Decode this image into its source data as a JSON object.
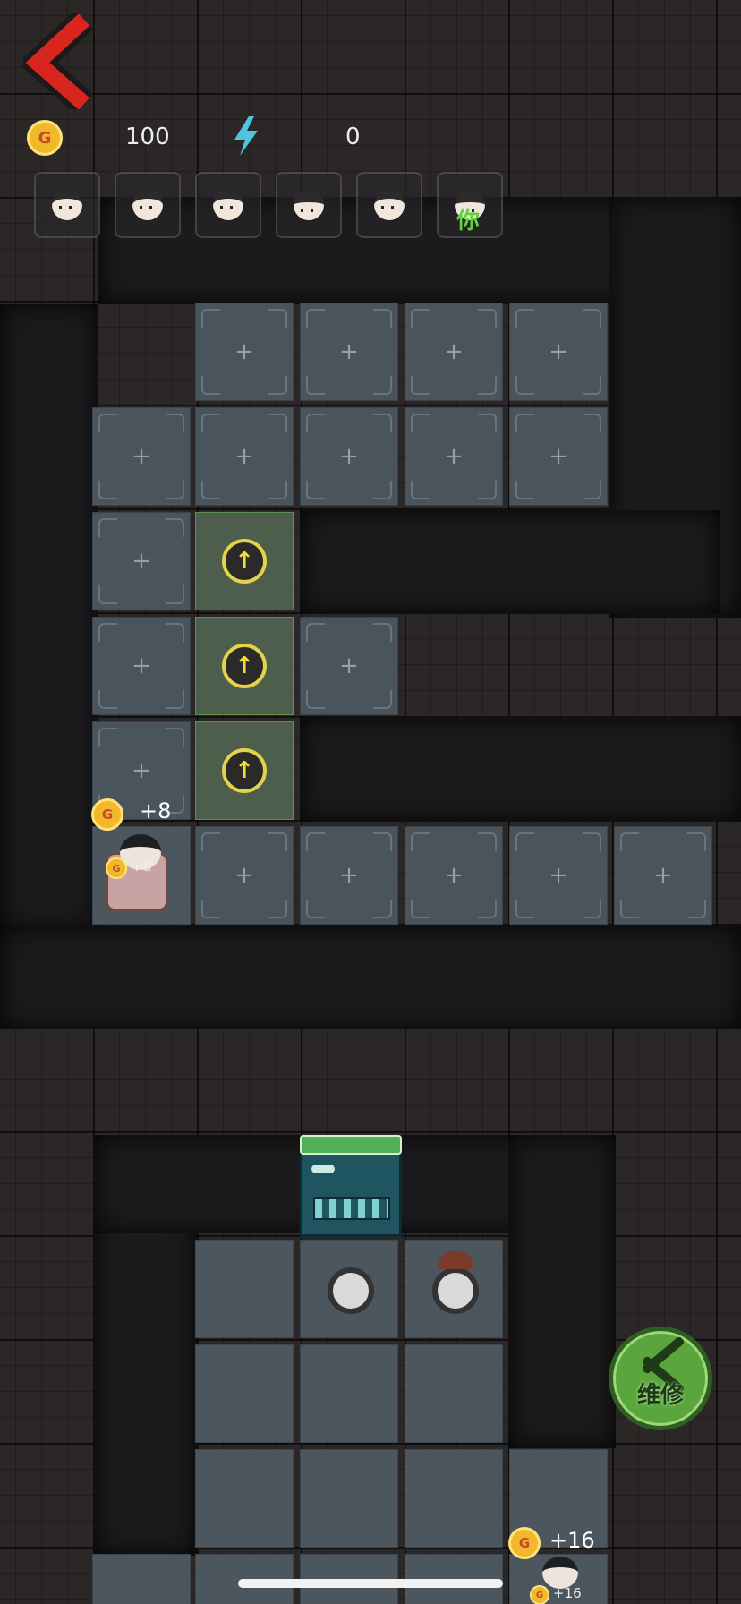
{
  "hud": {
    "back_icon": "chevron-left-icon",
    "coin_icon": "G",
    "coins": "100",
    "energy_icon": "lightning-icon",
    "energy": "0",
    "avatars": [
      {
        "name": "character-1"
      },
      {
        "name": "character-2"
      },
      {
        "name": "character-3"
      },
      {
        "name": "character-4"
      },
      {
        "name": "character-5"
      },
      {
        "name": "character-6",
        "tag": "你"
      }
    ]
  },
  "upper_room": {
    "plus": "+",
    "bed_gain": "+8",
    "bed_small_gain": "+8",
    "upgrade_glyph": "↑"
  },
  "lower_room": {
    "door_status": "green",
    "bottom_gain": "+16",
    "bottom_small_gain": "+16"
  },
  "repair_button": {
    "label": "维修"
  },
  "colors": {
    "back_arrow": "#d8261e",
    "coin": "#f0b82a",
    "energy": "#4fc3e0",
    "floor": "#4a545c",
    "upgrade_ring": "#e3d24a",
    "repair_bg": "#5aa63c",
    "you_tag": "#5fd23e"
  }
}
